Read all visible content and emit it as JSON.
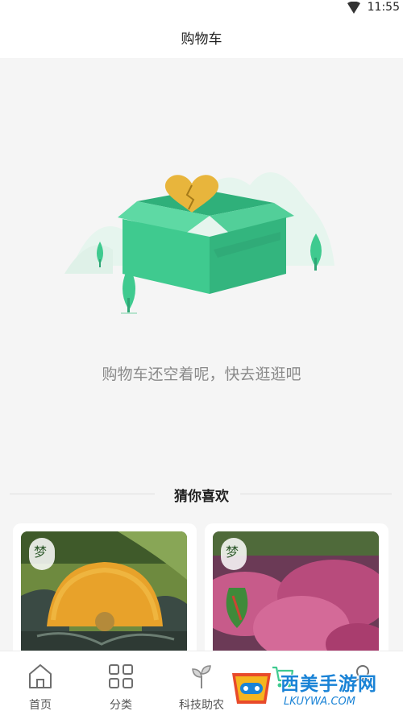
{
  "status_bar": {
    "time": "11:55",
    "icons": [
      "signal-icon"
    ]
  },
  "header": {
    "title": "购物车"
  },
  "empty_state": {
    "illustration": "empty-box-broken-heart",
    "message": "购物车还空着呢，快去逛逛吧"
  },
  "recommendations": {
    "title": "猜你喜欢",
    "products": [
      {
        "image": "pumpkin-photo",
        "logo_char": "梦"
      },
      {
        "image": "purple-sweet-potato-photo",
        "logo_char": "梦"
      }
    ]
  },
  "bottom_nav": {
    "items": [
      {
        "label": "首页",
        "icon": "home-icon"
      },
      {
        "label": "分类",
        "icon": "category-grid-icon"
      },
      {
        "label": "科技助农",
        "icon": "sprout-icon"
      },
      {
        "label": "",
        "icon": "cart-icon"
      },
      {
        "label": "",
        "icon": "profile-icon"
      }
    ]
  },
  "watermark": {
    "text": "西美手游网",
    "url": "LKUYWA.COM"
  },
  "colors": {
    "accent_green": "#3fca8f",
    "heart_yellow": "#e8b53c",
    "nav_icon": "#6e6e6e",
    "watermark_blue": "#1a83d6"
  }
}
